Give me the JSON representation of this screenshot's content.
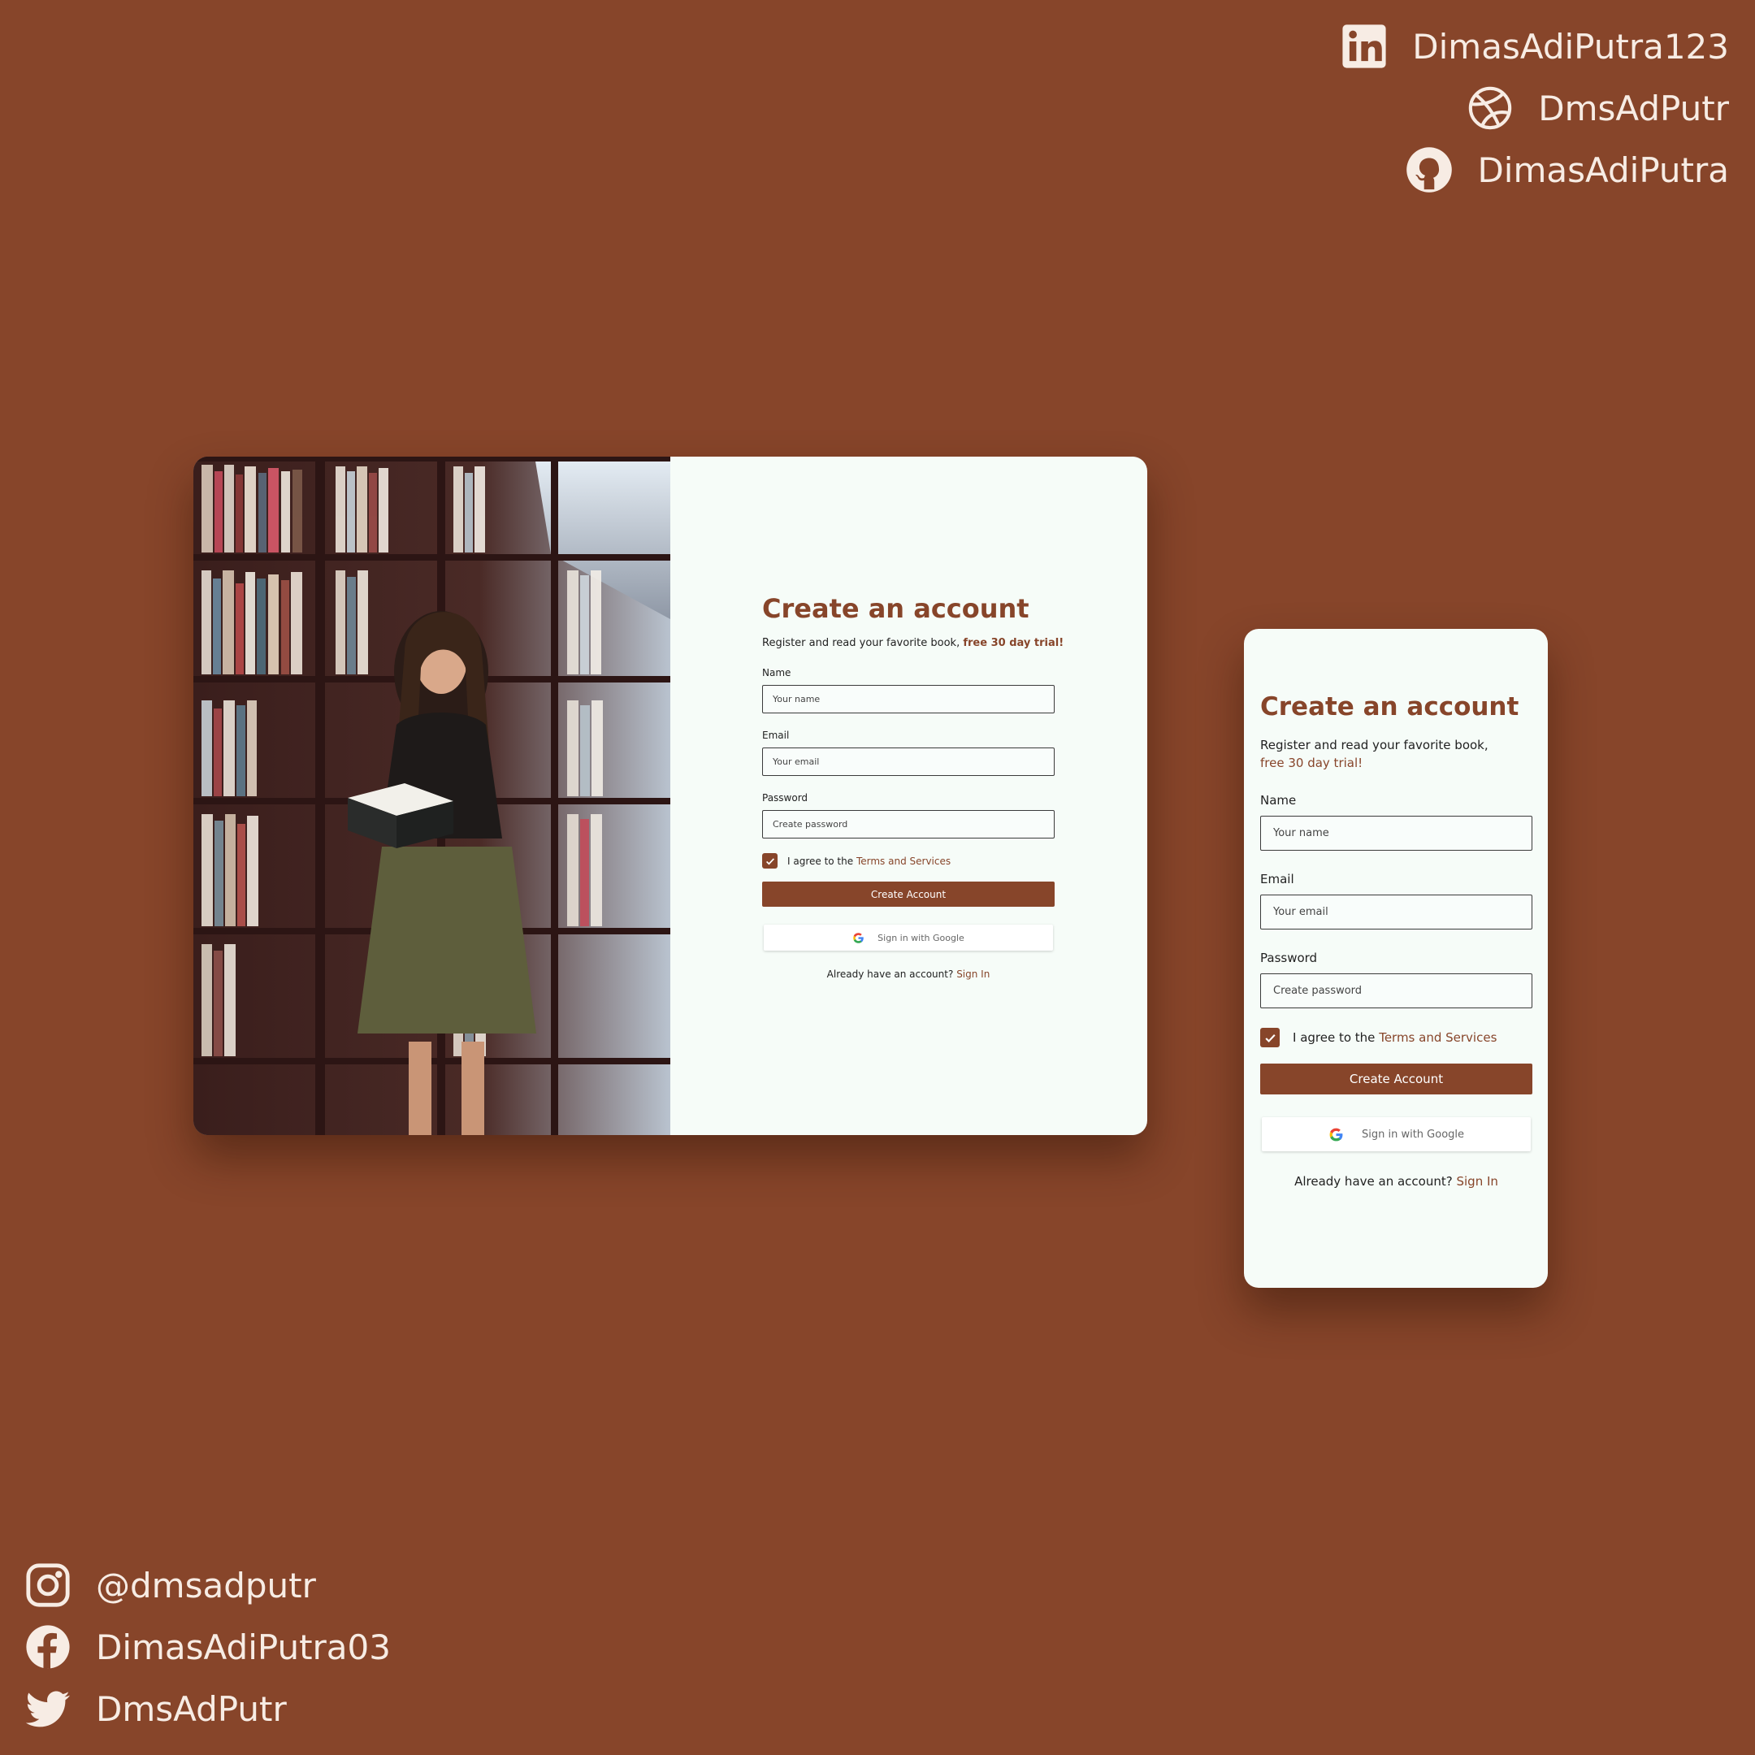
{
  "colors": {
    "background": "#87452a",
    "accent": "#87452a",
    "card": "#f6fcf8"
  },
  "social_top": [
    {
      "icon": "linkedin-icon",
      "handle": "DimasAdiPutra123"
    },
    {
      "icon": "dribbble-icon",
      "handle": "DmsAdPutr"
    },
    {
      "icon": "github-icon",
      "handle": "DimasAdiPutra"
    }
  ],
  "social_bottom": [
    {
      "icon": "instagram-icon",
      "handle": "@dmsadputr"
    },
    {
      "icon": "facebook-icon",
      "handle": "DimasAdiPutra03"
    },
    {
      "icon": "twitter-icon",
      "handle": "DmsAdPutr"
    }
  ],
  "form": {
    "title": "Create an account",
    "subtitle": "Register and read your favorite book,",
    "trial": "free 30 day trial!",
    "name_label": "Name",
    "name_placeholder": "Your name",
    "email_label": "Email",
    "email_placeholder": "Your email",
    "password_label": "Password",
    "password_placeholder": "Create password",
    "agree_text": "I agree to the",
    "terms_link": "Terms and Services",
    "terms_checked": true,
    "create_button": "Create Account",
    "google_button": "Sign in with Google",
    "have_account": "Already have an account?",
    "sign_in_link": "Sign In"
  }
}
